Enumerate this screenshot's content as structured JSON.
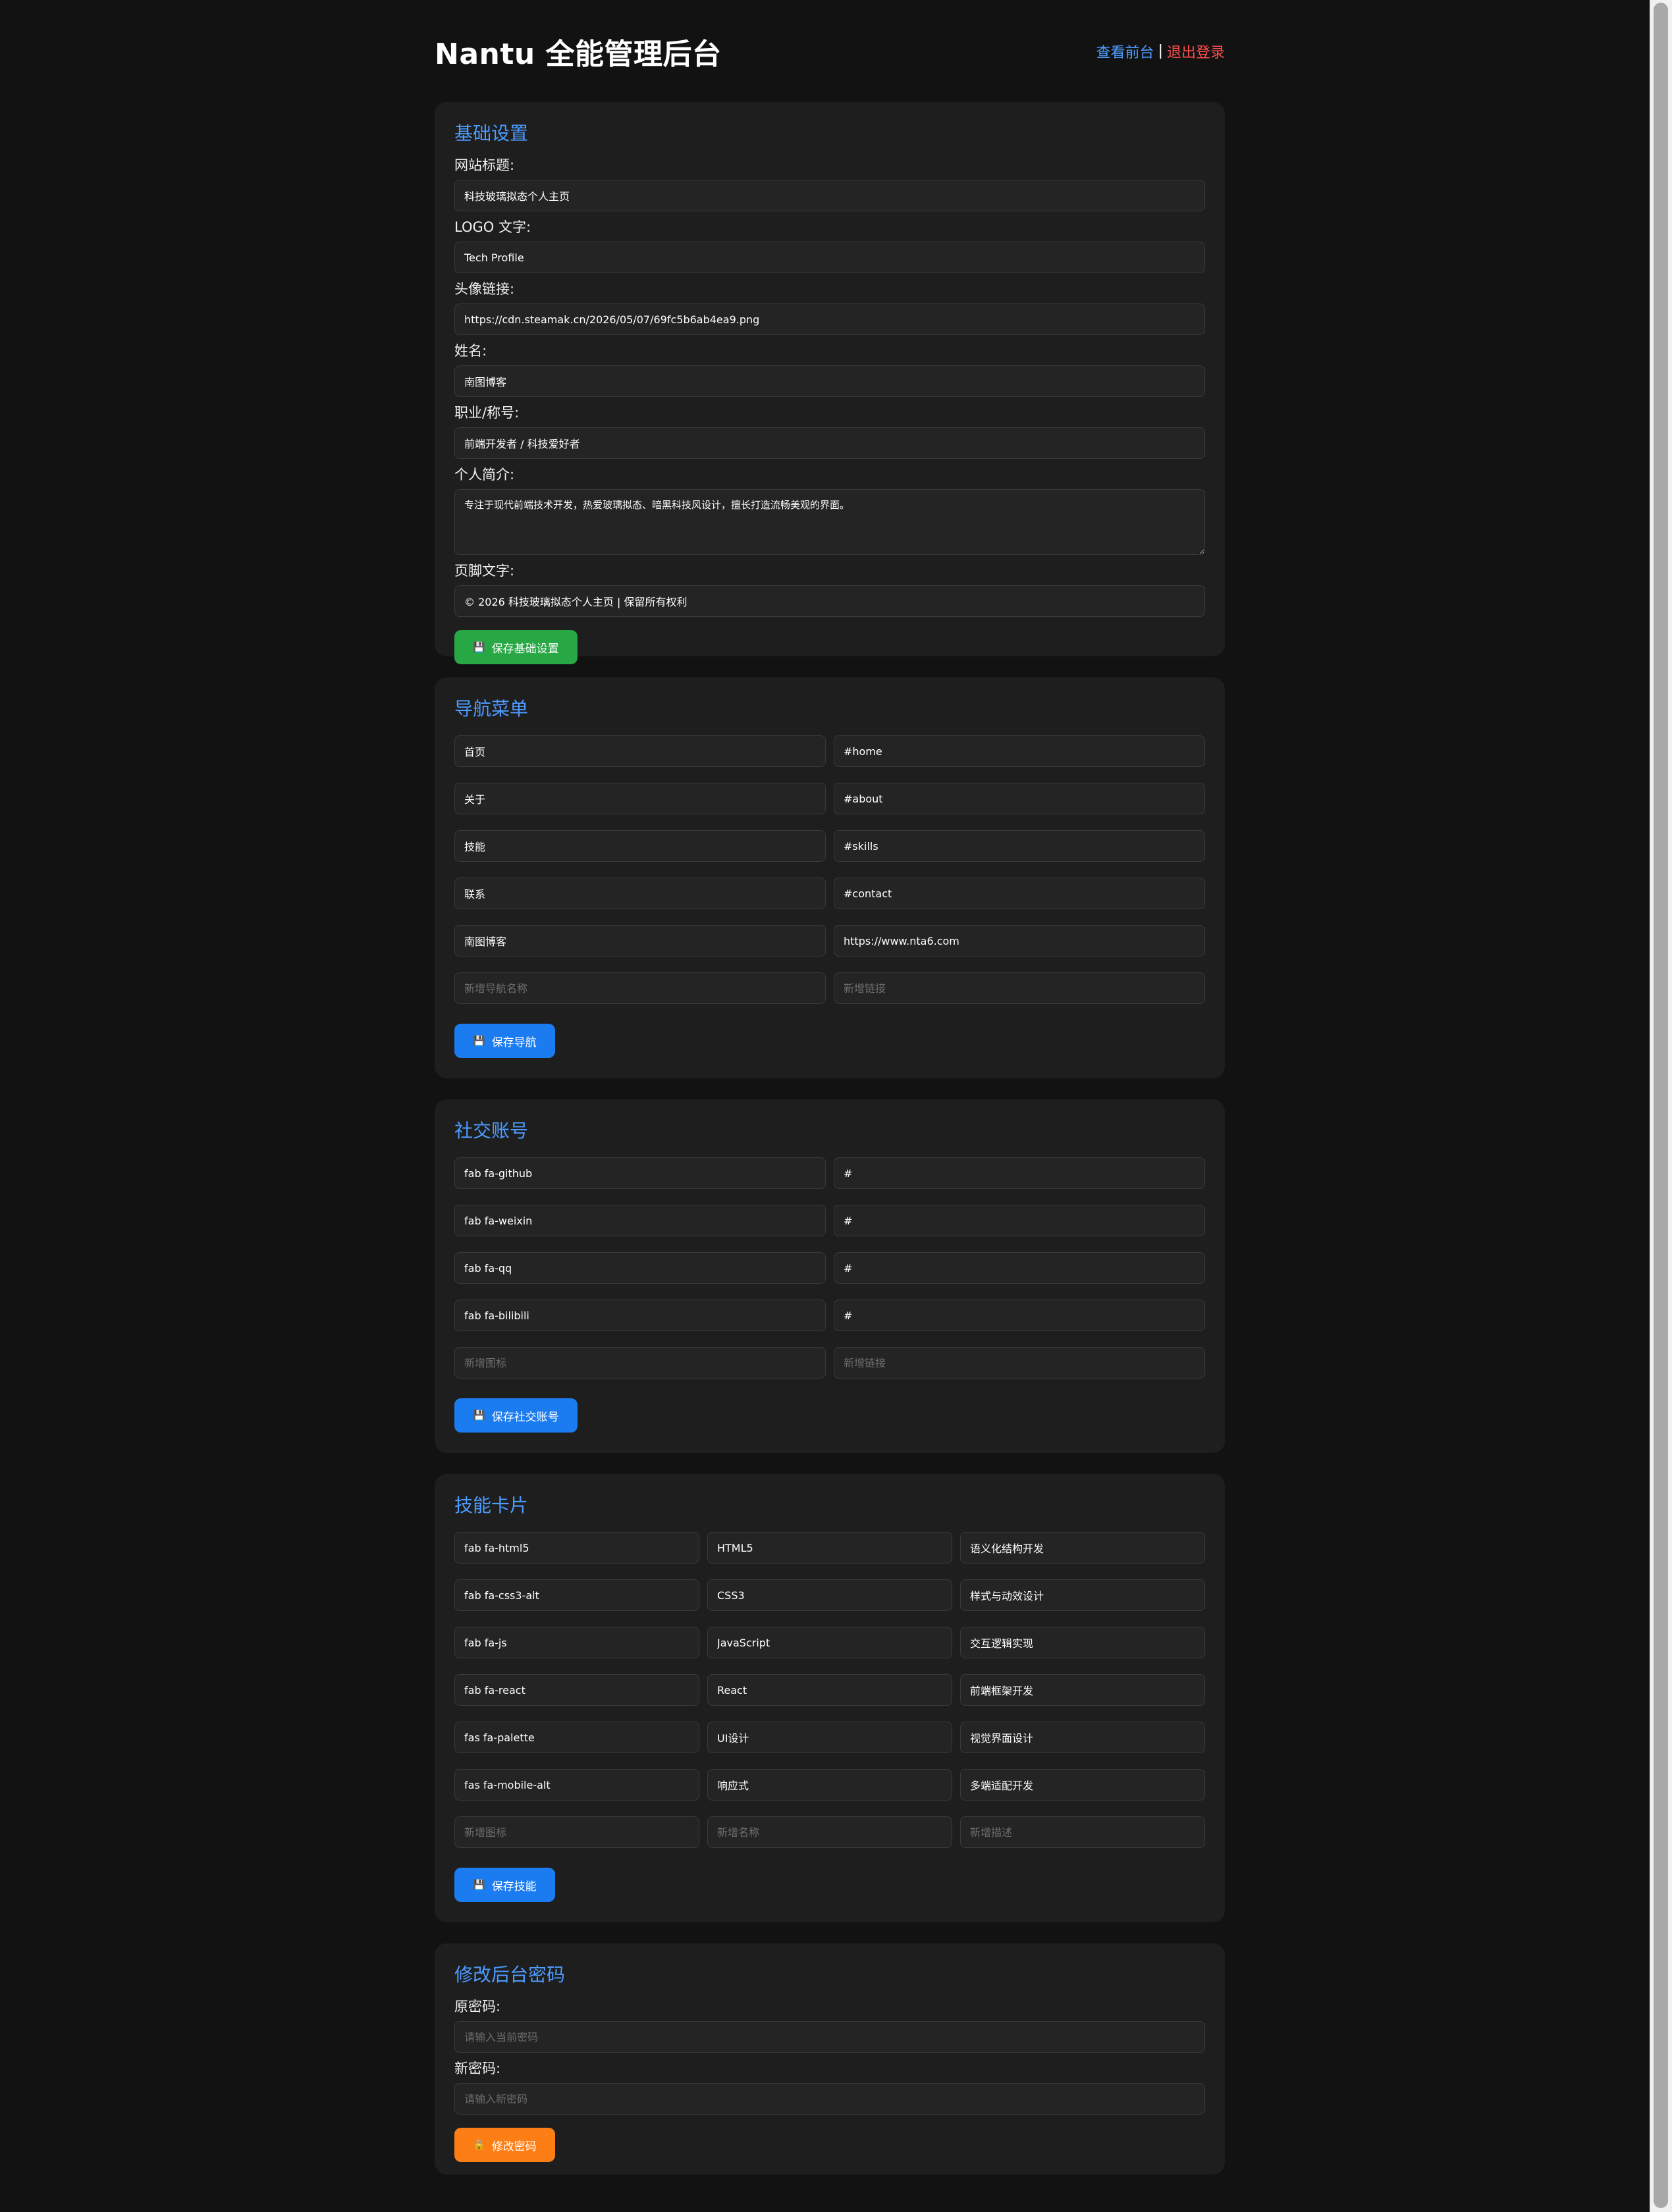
{
  "header": {
    "title": "Nantu 全能管理后台",
    "view_front": "查看前台",
    "separator": "|",
    "logout": "退出登录"
  },
  "basic": {
    "title": "基础设置",
    "fields": [
      {
        "label": "网站标题:",
        "value": "科技玻璃拟态个人主页"
      },
      {
        "label": "LOGO 文字:",
        "value": "Tech Profile"
      },
      {
        "label": "头像链接:",
        "value": "https://cdn.steamak.cn/2026/05/07/69fc5b6ab4ea9.png"
      },
      {
        "label": "姓名:",
        "value": "南图博客"
      },
      {
        "label": "职业/称号:",
        "value": "前端开发者 / 科技爱好者"
      },
      {
        "label": "个人简介:",
        "value": "专注于现代前端技术开发，热爱玻璃拟态、暗黑科技风设计，擅长打造流畅美观的界面。"
      },
      {
        "label": "页脚文字:",
        "value": "© 2026 科技玻璃拟态个人主页 | 保留所有权利"
      }
    ],
    "save_label": "保存基础设置",
    "save_icon": "floppy-disk-icon"
  },
  "nav": {
    "title": "导航菜单",
    "items": [
      {
        "name": "首页",
        "link": "#home"
      },
      {
        "name": "关于",
        "link": "#about"
      },
      {
        "name": "技能",
        "link": "#skills"
      },
      {
        "name": "联系",
        "link": "#contact"
      },
      {
        "name": "南图博客",
        "link": "https://www.nta6.com"
      }
    ],
    "new_name_placeholder": "新增导航名称",
    "new_link_placeholder": "新增链接",
    "save_label": "保存导航"
  },
  "social": {
    "title": "社交账号",
    "items": [
      {
        "icon": "fab fa-github",
        "link": "#"
      },
      {
        "icon": "fab fa-weixin",
        "link": "#"
      },
      {
        "icon": "fab fa-qq",
        "link": "#"
      },
      {
        "icon": "fab fa-bilibili",
        "link": "#"
      }
    ],
    "new_icon_placeholder": "新增图标",
    "new_link_placeholder": "新增链接",
    "save_label": "保存社交账号"
  },
  "skills": {
    "title": "技能卡片",
    "items": [
      {
        "icon": "fab fa-html5",
        "name": "HTML5",
        "desc": "语义化结构开发"
      },
      {
        "icon": "fab fa-css3-alt",
        "name": "CSS3",
        "desc": "样式与动效设计"
      },
      {
        "icon": "fab fa-js",
        "name": "JavaScript",
        "desc": "交互逻辑实现"
      },
      {
        "icon": "fab fa-react",
        "name": "React",
        "desc": "前端框架开发"
      },
      {
        "icon": "fas fa-palette",
        "name": "UI设计",
        "desc": "视觉界面设计"
      },
      {
        "icon": "fas fa-mobile-alt",
        "name": "响应式",
        "desc": "多端适配开发"
      }
    ],
    "new_icon_placeholder": "新增图标",
    "new_name_placeholder": "新增名称",
    "new_desc_placeholder": "新增描述",
    "save_label": "保存技能"
  },
  "password": {
    "title": "修改后台密码",
    "old_label": "原密码:",
    "old_placeholder": "请输入当前密码",
    "new_label": "新密码:",
    "new_placeholder": "请输入新密码",
    "save_label": "修改密码",
    "save_icon": "lock-icon"
  },
  "colors": {
    "background": "#121212",
    "card": "#1e1e1e",
    "accent": "#4d9cff",
    "logout": "#ff4d4d",
    "green": "#28a745",
    "blue": "#1a7cf0",
    "orange": "#fd7e14"
  }
}
